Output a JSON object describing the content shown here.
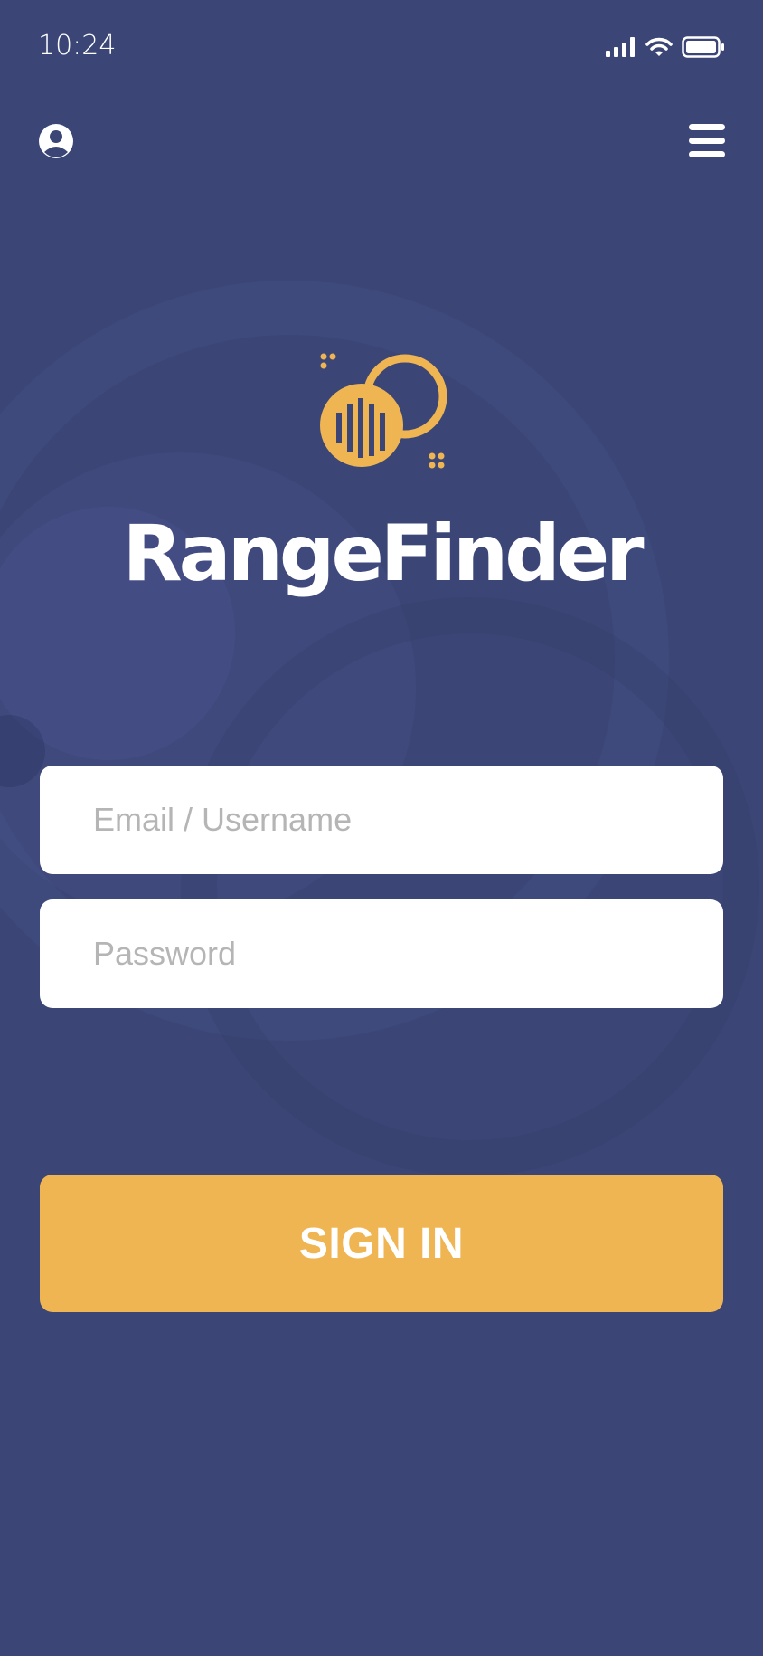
{
  "status_bar": {
    "time": "10:24",
    "icons": [
      "cellular-signal-icon",
      "wifi-icon",
      "battery-icon"
    ]
  },
  "header": {
    "icons": [
      "user-profile-icon",
      "hamburger-menu-icon"
    ]
  },
  "brand": {
    "logo_icon": "rangefinder-logo-icon",
    "name": "RangeFinder",
    "accent_color": "#efb553"
  },
  "form": {
    "email_placeholder": "Email / Username",
    "email_value": "",
    "password_placeholder": "Password",
    "password_value": "",
    "signin_label": "SIGN IN"
  },
  "colors": {
    "background": "#3b4676",
    "field_bg": "#ffffff",
    "placeholder": "#b5b5b5",
    "button": "#efb553",
    "text_light": "#ffffff"
  }
}
